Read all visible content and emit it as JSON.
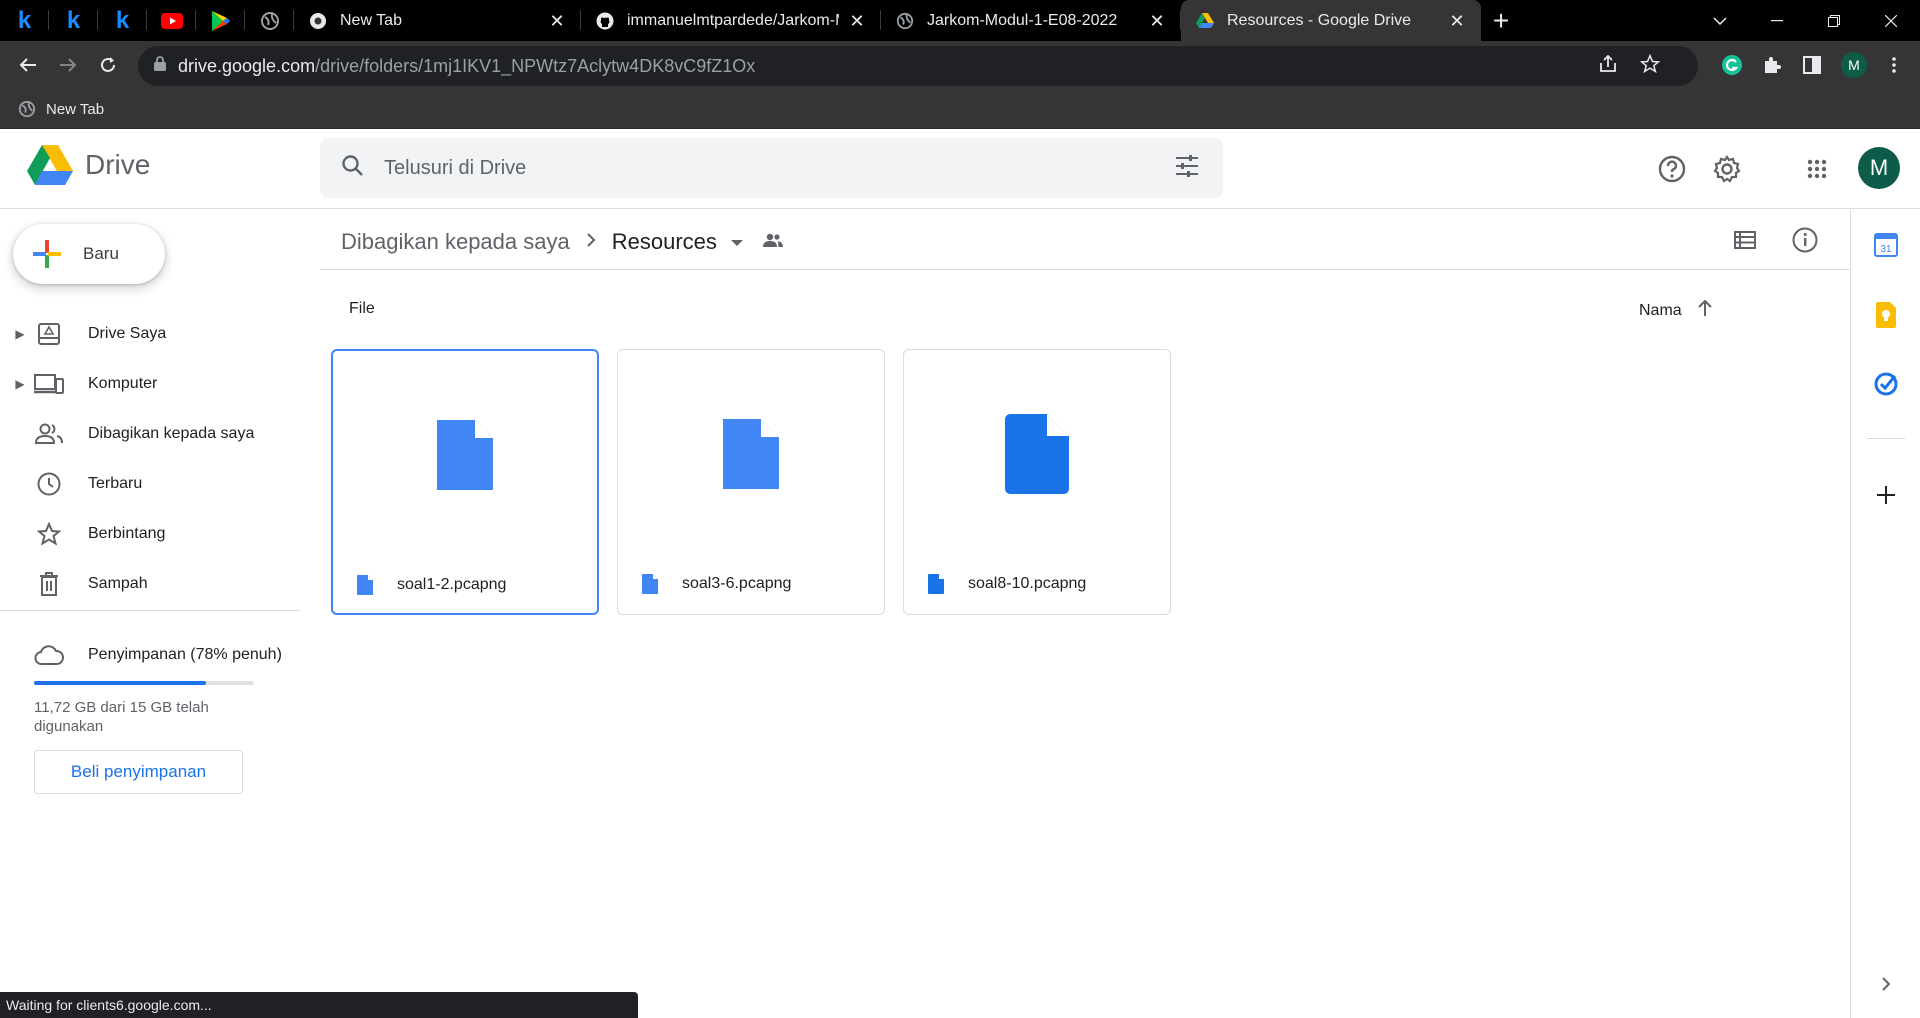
{
  "browser": {
    "pinned_tabs": [
      {
        "icon": "k-icon",
        "label": "k"
      },
      {
        "icon": "k-icon",
        "label": "k"
      },
      {
        "icon": "k-icon",
        "label": "k"
      },
      {
        "icon": "youtube-icon"
      },
      {
        "icon": "play-store-icon"
      },
      {
        "icon": "globe-icon"
      }
    ],
    "tabs": [
      {
        "title": "New Tab",
        "active": false
      },
      {
        "title": "immanuelmtpardede/Jarkom-Mo",
        "active": false
      },
      {
        "title": "Jarkom-Modul-1-E08-2022",
        "active": false
      },
      {
        "title": "Resources - Google Drive",
        "active": true
      }
    ],
    "url_host": "drive.google.com",
    "url_path": "/drive/folders/1mj1IKV1_NPWtz7Aclytw4DK8vC9fZ1Ox",
    "bookmark": "New Tab",
    "profile_initial": "M",
    "status": "Waiting for clients6.google.com..."
  },
  "drive": {
    "app_name": "Drive",
    "search_placeholder": "Telusuri di Drive",
    "avatar_initial": "M",
    "new_button": "Baru",
    "nav": [
      {
        "label": "Drive Saya",
        "icon": "my-drive-icon",
        "expandable": true
      },
      {
        "label": "Komputer",
        "icon": "computer-icon",
        "expandable": true
      },
      {
        "label": "Dibagikan kepada saya",
        "icon": "shared-icon",
        "expandable": false
      },
      {
        "label": "Terbaru",
        "icon": "clock-icon",
        "expandable": false
      },
      {
        "label": "Berbintang",
        "icon": "star-icon",
        "expandable": false
      },
      {
        "label": "Sampah",
        "icon": "trash-icon",
        "expandable": false
      }
    ],
    "storage": {
      "label": "Penyimpanan (78% penuh)",
      "percent": 78,
      "detail": "11,72 GB dari 15 GB telah digunakan",
      "buy": "Beli penyimpanan"
    },
    "breadcrumb": {
      "parent": "Dibagikan kepada saya",
      "current": "Resources"
    },
    "section_label": "File",
    "sort_label": "Nama",
    "files": [
      {
        "name": "soal1-2.pcapng",
        "selected": true
      },
      {
        "name": "soal3-6.pcapng",
        "selected": false
      },
      {
        "name": "soal8-10.pcapng",
        "selected": false
      }
    ],
    "colors": {
      "accent": "#1a73e8",
      "file_icon": "#4285f4",
      "file_icon_dark": "#1a73e8"
    }
  }
}
